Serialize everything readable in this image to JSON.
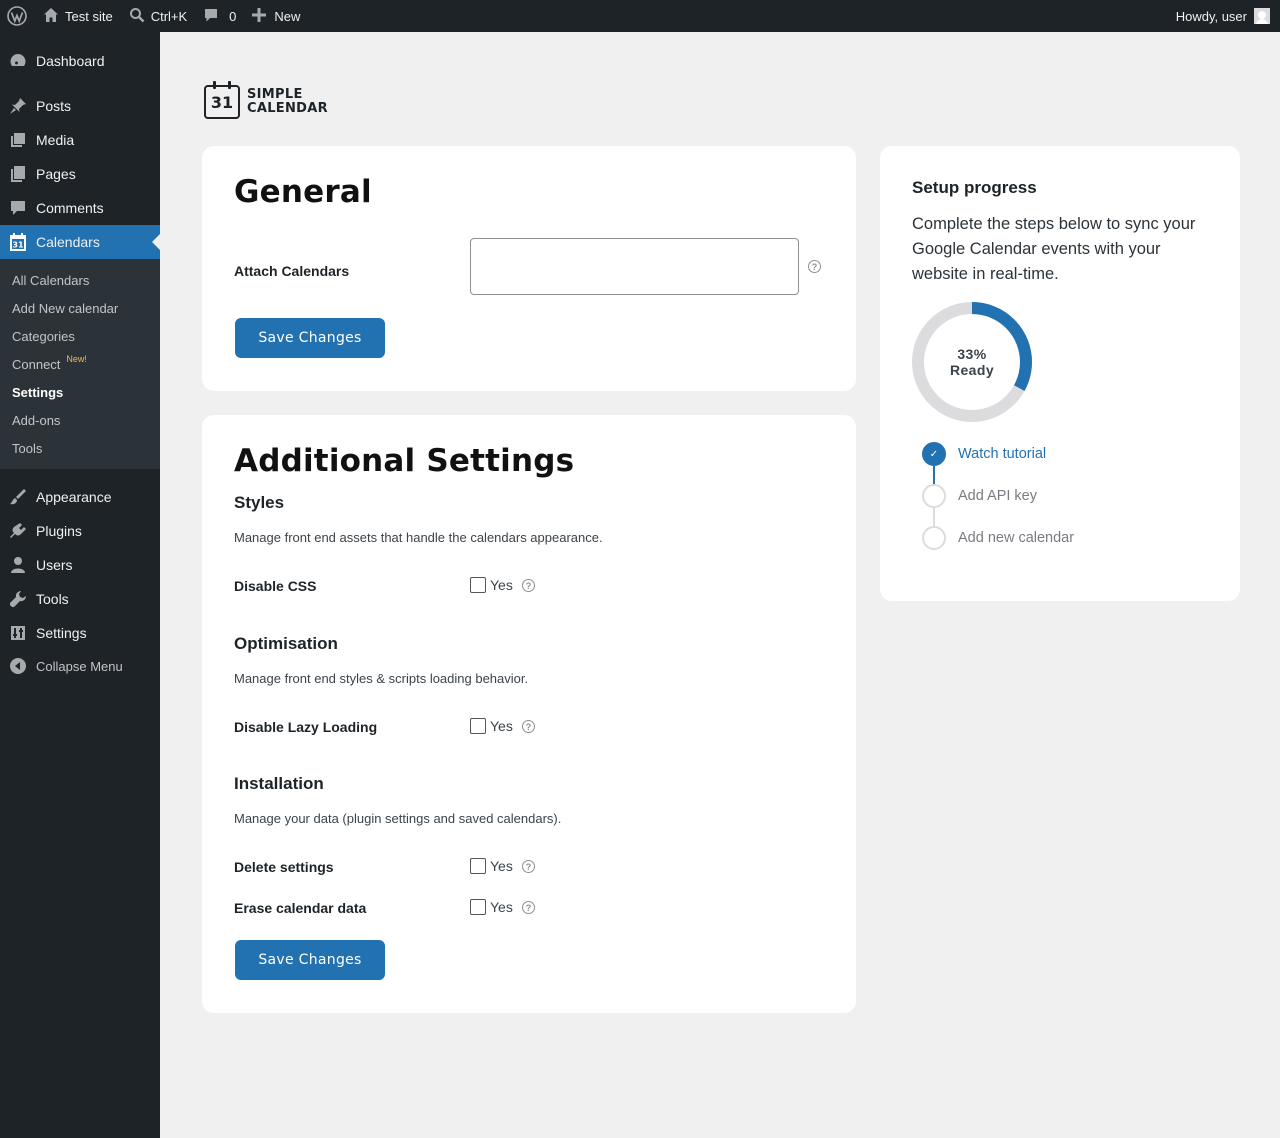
{
  "adminbar": {
    "site_name": "Test site",
    "search_shortcut": "Ctrl+K",
    "comments_count": "0",
    "new_label": "New",
    "greeting": "Howdy, user"
  },
  "sidebar": {
    "items_top": [
      {
        "label": "Dashboard",
        "icon": "dashboard-icon"
      },
      {
        "label": "Posts",
        "icon": "pin-icon"
      },
      {
        "label": "Media",
        "icon": "media-icon"
      },
      {
        "label": "Pages",
        "icon": "pages-icon"
      },
      {
        "label": "Comments",
        "icon": "comment-icon"
      },
      {
        "label": "Calendars",
        "icon": "calendar-icon"
      }
    ],
    "submenu": [
      "All Calendars",
      "Add New calendar",
      "Categories",
      "Connect",
      "Settings",
      "Add-ons",
      "Tools"
    ],
    "connect_badge": "New!",
    "items_bottom": [
      {
        "label": "Appearance",
        "icon": "brush-icon"
      },
      {
        "label": "Plugins",
        "icon": "plugin-icon"
      },
      {
        "label": "Users",
        "icon": "user-icon"
      },
      {
        "label": "Tools",
        "icon": "wrench-icon"
      },
      {
        "label": "Settings",
        "icon": "settings-icon"
      }
    ],
    "collapse_label": "Collapse Menu"
  },
  "logo": {
    "day": "31",
    "line1": "SIMPLE",
    "line2": "CALENDAR"
  },
  "general": {
    "title": "General",
    "attach_label": "Attach Calendars",
    "attach_value": "",
    "save_label": "Save Changes"
  },
  "additional": {
    "title": "Additional Settings",
    "styles_title": "Styles",
    "styles_desc": "Manage front end assets that handle the calendars appearance.",
    "disable_css_label": "Disable CSS",
    "optimisation_title": "Optimisation",
    "optimisation_desc": "Manage front end styles & scripts loading behavior.",
    "lazy_label": "Disable Lazy Loading",
    "installation_title": "Installation",
    "installation_desc": "Manage your data (plugin settings and saved calendars).",
    "delete_label": "Delete settings",
    "erase_label": "Erase calendar data",
    "yes": "Yes",
    "help": "?",
    "save_label": "Save Changes"
  },
  "setup": {
    "title": "Setup progress",
    "description": "Complete the steps below to sync your Google Calendar events with your website in real-time.",
    "progress": 0.33,
    "progress_text": "33%",
    "ready_text": "Ready",
    "steps": [
      {
        "label": "Watch tutorial",
        "done": true
      },
      {
        "label": "Add API key",
        "done": false
      },
      {
        "label": "Add new calendar",
        "done": false
      }
    ],
    "colors": {
      "accent": "#2271b1",
      "track": "#dcdcde"
    }
  }
}
